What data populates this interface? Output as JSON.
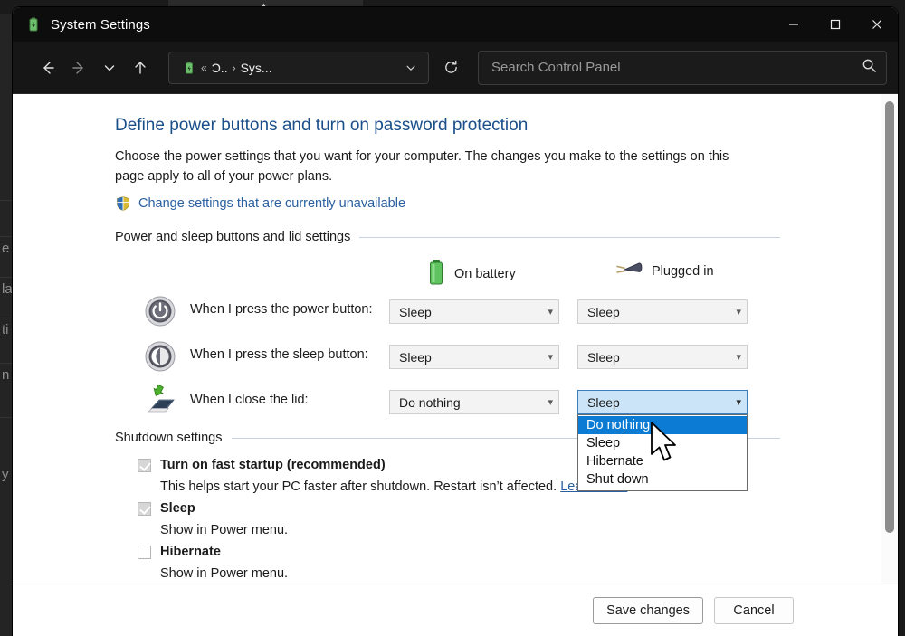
{
  "window": {
    "title": "System Settings",
    "icon": "power-plan-icon",
    "controls": {
      "minimize": "minimize-icon",
      "maximize": "maximize-icon",
      "close": "close-icon"
    }
  },
  "toolbar": {
    "back": "back-arrow-icon",
    "forward": "forward-arrow-icon",
    "recent": "chevron-down-icon",
    "up": "up-arrow-icon",
    "breadcrumb": {
      "icon": "power-plan-icon",
      "overflow": "«",
      "segments": [
        "Ɔ..",
        "Sys..."
      ],
      "separator": "›",
      "dropdown": "chevron-down-icon"
    },
    "refresh": "refresh-icon"
  },
  "search": {
    "placeholder": "Search Control Panel",
    "value": "",
    "icon": "search-icon"
  },
  "page": {
    "title": "Define power buttons and turn on password protection",
    "description": "Choose the power settings that you want for your computer. The changes you make to the settings on this page apply to all of your power plans.",
    "uac_link": "Change settings that are currently unavailable",
    "uac_icon": "shield-icon"
  },
  "power_group": {
    "heading": "Power and sleep buttons and lid settings",
    "columns": [
      {
        "label": "On battery",
        "icon": "battery-icon"
      },
      {
        "label": "Plugged in",
        "icon": "power-plug-icon"
      }
    ],
    "rows": [
      {
        "icon": "power-button-icon",
        "label": "When I press the power button:",
        "battery_value": "Sleep",
        "plugged_value": "Sleep",
        "arrow": "chevron-down-icon"
      },
      {
        "icon": "sleep-moon-icon",
        "label": "When I press the sleep button:",
        "battery_value": "Sleep",
        "plugged_value": "Sleep",
        "arrow": "chevron-down-icon"
      },
      {
        "icon": "laptop-lid-icon",
        "label": "When I close the lid:",
        "battery_value": "Do nothing",
        "plugged_value": "Sleep",
        "arrow": "chevron-down-icon"
      }
    ],
    "open_dropdown": {
      "owner": "lid-plugged-in-combobox",
      "selected": "Do nothing",
      "options": [
        "Do nothing",
        "Sleep",
        "Hibernate",
        "Shut down"
      ]
    }
  },
  "shutdown_group": {
    "heading": "Shutdown settings",
    "items": [
      {
        "title": "Turn on fast startup (recommended)",
        "checked": true,
        "disabled": true,
        "sub": "This helps start your PC faster after shutdown. Restart isn’t affected.",
        "link": "Learn More"
      },
      {
        "title": "Sleep",
        "checked": true,
        "disabled": true,
        "sub": "Show in Power menu.",
        "link": ""
      },
      {
        "title": "Hibernate",
        "checked": false,
        "disabled": true,
        "sub": "Show in Power menu.",
        "link": ""
      }
    ]
  },
  "footer": {
    "save_label": "Save changes",
    "cancel_label": "Cancel"
  },
  "background": {
    "fragments": [
      "e t",
      "la",
      "ti",
      "n",
      "y"
    ]
  },
  "colors": {
    "accent": "#0b7bd4",
    "title_link": "#1a4f8a",
    "link": "#2a5fa0",
    "titlebar_bg": "#0d0d0d",
    "toolbar_bg": "#161616",
    "selected_row": "#0b7bd4",
    "focused_combo": "#cce4f7"
  }
}
